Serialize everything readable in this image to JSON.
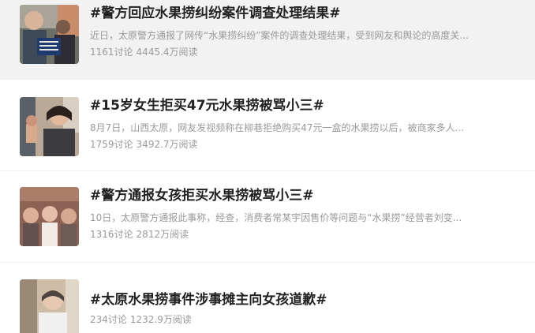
{
  "topics": [
    {
      "title": "#警方回应水果捞纠纷案件调查处理结果#",
      "description": "近日，太原警方通报了网传“水果捞纠纷”案件的调查处理结果，受到网友和舆论的高度关...",
      "discussions": "1161讨论",
      "reads": "4445.4万阅读",
      "thumbnail": "news-photo-police-statement"
    },
    {
      "title": "#15岁女生拒买47元水果捞被骂小三#",
      "description": "8月7日，山西太原，网友发视频称在柳巷拒绝购买47元一盒的水果捞以后，被商家多人...",
      "discussions": "1759讨论",
      "reads": "3492.7万阅读",
      "thumbnail": "news-photo-vendor-woman"
    },
    {
      "title": "#警方通报女孩拒买水果捞被骂小三#",
      "description": "10日，太原警方通报此事称，经查，消费者常某宇因售价等问题与“水果捞”经营者刘变...",
      "discussions": "1316讨论",
      "reads": "2812万阅读",
      "thumbnail": "news-photo-blurred-crowd"
    },
    {
      "title": "#太原水果捞事件涉事摊主向女孩道歉#",
      "description": "",
      "discussions": "234讨论",
      "reads": "1232.9万阅读",
      "thumbnail": "news-photo-blurred-person"
    }
  ],
  "colors": {
    "highlight_bg": "#f2f2f2",
    "title": "#222222",
    "secondary_text": "#999999"
  }
}
